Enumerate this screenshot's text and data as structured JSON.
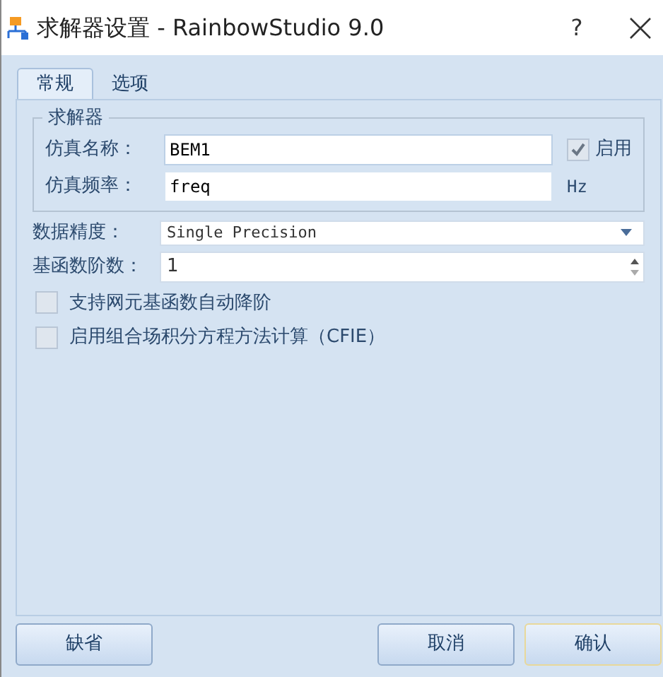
{
  "window": {
    "title": "求解器设置 - RainbowStudio 9.0",
    "help": "?"
  },
  "tabs": [
    {
      "label": "常规",
      "selected": true
    },
    {
      "label": "选项",
      "selected": false
    }
  ],
  "solver_group": {
    "title": "求解器",
    "name_label": "仿真名称：",
    "name_value": "BEM1",
    "enable_label": "启用",
    "enabled": true,
    "freq_label": "仿真频率：",
    "freq_value": "freq",
    "freq_unit": "Hz"
  },
  "precision": {
    "label": "数据精度：",
    "value": "Single Precision"
  },
  "basis_order": {
    "label": "基函数阶数：",
    "value": "1"
  },
  "options": [
    {
      "label": "支持网元基函数自动降阶",
      "checked": false
    },
    {
      "label": "启用组合场积分方程方法计算（CFIE）",
      "checked": false
    }
  ],
  "buttons": [
    {
      "label": "缺省",
      "default": false
    },
    {
      "label": "取消",
      "default": false
    },
    {
      "label": "确认",
      "default": true
    }
  ]
}
